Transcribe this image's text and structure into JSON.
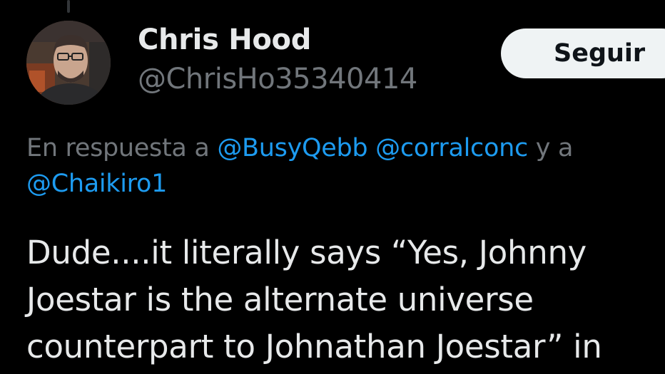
{
  "author": {
    "display_name": "Chris Hood",
    "handle": "@ChrisHo35340414",
    "avatar": "profile-photo"
  },
  "follow_button": {
    "label": "Seguir"
  },
  "reply_context": {
    "prefix": "En respuesta a ",
    "mentions": [
      "@BusyQebb",
      "@corralconc"
    ],
    "connector": " y a",
    "line2_mention": "@Chaikiro1"
  },
  "tweet": {
    "lines": [
      "Dude....it literally says  “Yes, Johnny",
      "Joestar is the alternate universe",
      "counterpart to Johnathan Joestar” in"
    ]
  },
  "colors": {
    "background": "#000000",
    "text_primary": "#e7e9ea",
    "text_secondary": "#71767b",
    "link": "#1d9bf0",
    "button_bg": "#eff3f4",
    "button_text": "#0f1419"
  }
}
